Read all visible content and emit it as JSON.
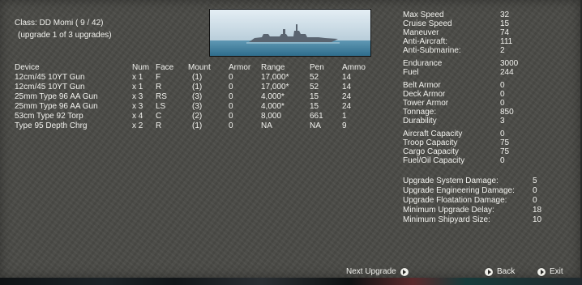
{
  "header": {
    "class_line": "Class: DD Momi  ( 9 / 42)",
    "upgrade_line": "(upgrade 1 of 3 upgrades)"
  },
  "table": {
    "headers": [
      "Device",
      "Num",
      "Face",
      "Mount",
      "Armor",
      "Range",
      "Pen",
      "Ammo"
    ],
    "rows": [
      [
        "12cm/45 10YT Gun",
        "x 1",
        "F",
        "(1)",
        "0",
        "17,000*",
        "52",
        "14"
      ],
      [
        "12cm/45 10YT Gun",
        "x 1",
        "R",
        "(1)",
        "0",
        "17,000*",
        "52",
        "14"
      ],
      [
        "25mm Type 96 AA Gun",
        "x 3",
        "RS",
        "(3)",
        "0",
        "4,000*",
        "15",
        "24"
      ],
      [
        "25mm Type 96 AA Gun",
        "x 3",
        "LS",
        "(3)",
        "0",
        "4,000*",
        "15",
        "24"
      ],
      [
        "53cm Type 92 Torp",
        "x 4",
        "C",
        "(2)",
        "0",
        "8,000",
        "661",
        "1"
      ],
      [
        "Type 95 Depth Chrg",
        "x 2",
        "R",
        "(1)",
        "0",
        "NA",
        "NA",
        "9"
      ]
    ]
  },
  "stats": {
    "group1": [
      {
        "label": "Max Speed",
        "value": "32"
      },
      {
        "label": "Cruise Speed",
        "value": "15"
      },
      {
        "label": "Maneuver",
        "value": "74"
      },
      {
        "label": "Anti-Aircraft:",
        "value": "111"
      },
      {
        "label": "Anti-Submarine:",
        "value": "2"
      }
    ],
    "group2": [
      {
        "label": "Endurance",
        "value": "3000"
      },
      {
        "label": "Fuel",
        "value": "244"
      }
    ],
    "group3": [
      {
        "label": "Belt Armor",
        "value": "0"
      },
      {
        "label": "Deck Armor",
        "value": "0"
      },
      {
        "label": "Tower Armor",
        "value": "0"
      },
      {
        "label": "Tonnage:",
        "value": "850"
      },
      {
        "label": "Durability",
        "value": "3"
      }
    ],
    "group4": [
      {
        "label": "Aircraft Capacity",
        "value": "0"
      },
      {
        "label": "Troop Capacity",
        "value": "75"
      },
      {
        "label": "Cargo Capacity",
        "value": "75"
      },
      {
        "label": "Fuel/Oil Capacity",
        "value": "0"
      }
    ],
    "group5": [
      {
        "label": "Upgrade System Damage:",
        "value": "5"
      },
      {
        "label": "Upgrade Engineering Damage:",
        "value": "0"
      },
      {
        "label": "Upgrade Floatation Damage:",
        "value": "0"
      },
      {
        "label": "Minimum Upgrade Delay:",
        "value": "18"
      },
      {
        "label": "Minimum Shipyard Size:",
        "value": "10"
      }
    ]
  },
  "buttons": {
    "next_upgrade": "Next Upgrade",
    "back": "Back",
    "exit": "Exit"
  },
  "icons": {
    "next_upgrade": "arrow-right-icon",
    "back": "arrow-right-icon",
    "exit": "arrow-right-icon"
  },
  "colors": {
    "panel": "#4a4a46",
    "text": "#f2f2ee",
    "sky": "#bcd2e0",
    "sea": "#3f7e9c"
  }
}
